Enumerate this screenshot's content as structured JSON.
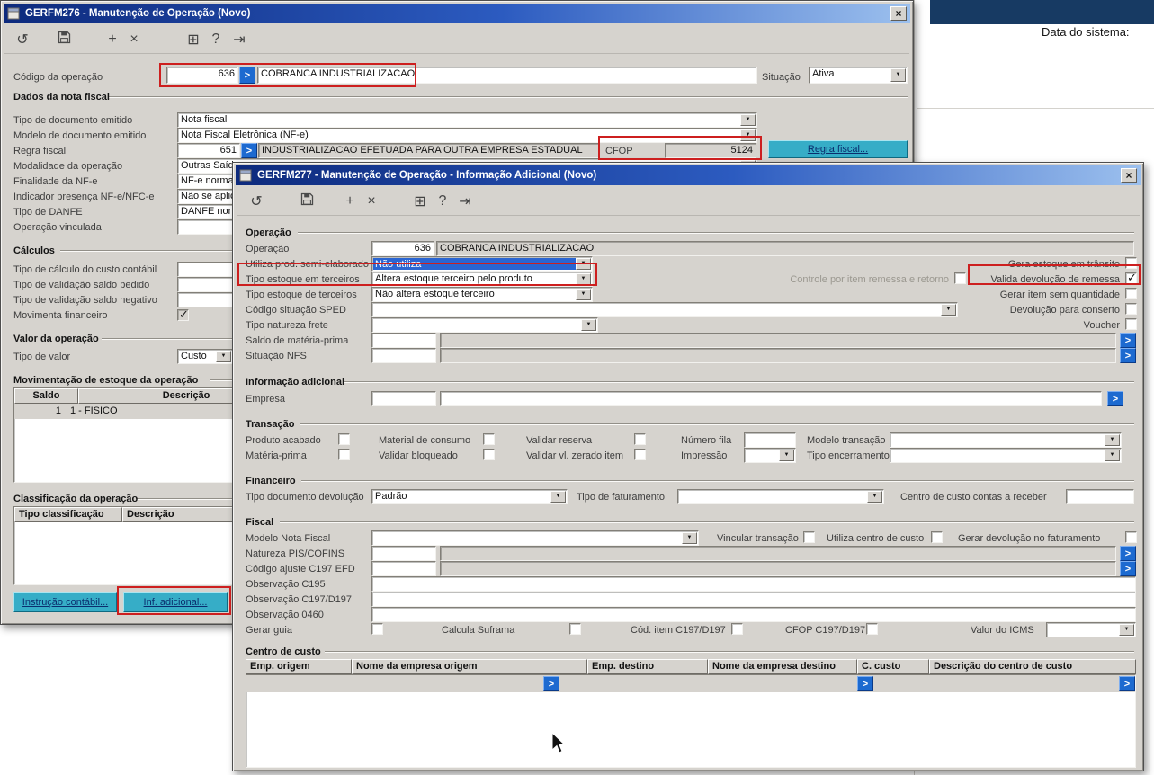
{
  "icons": {
    "undo": "↺",
    "new": "+",
    "delete": "×",
    "calendar": "⊞",
    "help": "?",
    "exit": "⇥",
    "close": "×",
    "dropdown": "▼",
    "lookup": ">"
  },
  "system_panel": {
    "date_label": "Data do sistema:"
  },
  "win276": {
    "title": "GERFM276 - Manutenção de Operação (Novo)",
    "codigo_label": "Código da operação",
    "codigo_value": "636",
    "codigo_desc": "COBRANCA INDUSTRIALIZACAO",
    "situacao_label": "Situação",
    "situacao_value": "Ativa",
    "nf": {
      "group": "Dados da nota fiscal",
      "tipo_doc_label": "Tipo de documento emitido",
      "tipo_doc_value": "Nota fiscal",
      "modelo_doc_label": "Modelo de documento emitido",
      "modelo_doc_value": "Nota Fiscal Eletrônica (NF-e)",
      "regra_label": "Regra fiscal",
      "regra_value": "651",
      "regra_desc": "INDUSTRIALIZACAO EFETUADA PARA OUTRA EMPRESA ESTADUAL",
      "cfop_label": "CFOP",
      "cfop_value": "5124",
      "regra_btn": "Regra fiscal...",
      "modalidade_label": "Modalidade da operação",
      "modalidade_value": "Outras Saídas",
      "finalidade_label": "Finalidade da NF-e",
      "finalidade_value": "NF-e normal",
      "indicador_label": "Indicador presença NF-e/NFC-e",
      "indicador_value": "Não se aplica",
      "danfe_label": "Tipo de DANFE",
      "danfe_value": "DANFE normal",
      "vinculada_label": "Operação vinculada"
    },
    "calc": {
      "group": "Cálculos",
      "custo_label": "Tipo de cálculo do custo contábil",
      "saldo_pedido_label": "Tipo de validação saldo pedido",
      "saldo_negativo_label": "Tipo de validação saldo negativo",
      "mov_financeiro_label": "Movimenta financeiro"
    },
    "valor": {
      "group": "Valor da operação",
      "tipo_label": "Tipo de valor",
      "tipo_value": "Custo"
    },
    "mov": {
      "group": "Movimentação de estoque da operação",
      "col1": "Saldo",
      "col2": "Descrição",
      "row_saldo": "1",
      "row_desc": "1 - FISICO"
    },
    "clas": {
      "group": "Classificação da operação",
      "col1": "Tipo classificação",
      "col2": "Descrição"
    },
    "btn_instrucao": "Instrução contábil...",
    "btn_inf": "Inf. adicional..."
  },
  "win277": {
    "title": "GERFM277 - Manutenção de Operação - Informação Adicional (Novo)",
    "op": {
      "group": "Operação",
      "operacao_label": "Operação",
      "operacao_value": "636",
      "operacao_desc": "COBRANCA INDUSTRIALIZACAO",
      "semi_label": "Utiliza prod. semi-elaborado",
      "semi_value": "Não utiliza",
      "estoque_em_label": "Tipo estoque em terceiros",
      "estoque_em_value": "Altera estoque terceiro pelo produto",
      "estoque_de_label": "Tipo estoque de terceiros",
      "estoque_de_value": "Não altera estoque terceiro",
      "sped_label": "Código situação SPED",
      "frete_label": "Tipo natureza frete",
      "saldo_mp_label": "Saldo de matéria-prima",
      "nfs_label": "Situação NFS",
      "chk_transito": "Gera estoque em trânsito",
      "chk_controle": "Controle por item remessa e retorno",
      "chk_valida": "Valida devolução de remessa",
      "chk_sem_qtd": "Gerar item sem quantidade",
      "chk_conserto": "Devolução para conserto",
      "chk_voucher": "Voucher"
    },
    "info": {
      "group": "Informação adicional",
      "empresa_label": "Empresa"
    },
    "trans": {
      "group": "Transação",
      "produto_acabado": "Produto acabado",
      "material_consumo": "Material de consumo",
      "validar_reserva": "Validar reserva",
      "numero_fila": "Número fila",
      "modelo_transacao": "Modelo transação",
      "materia_prima": "Matéria-prima",
      "validar_bloqueado": "Validar bloqueado",
      "validar_zerado": "Validar vl. zerado item",
      "impressao": "Impressão",
      "tipo_encerramento": "Tipo encerramento"
    },
    "fin": {
      "group": "Financeiro",
      "tipo_doc_label": "Tipo documento devolução",
      "tipo_doc_value": "Padrão",
      "faturamento_label": "Tipo de faturamento",
      "centro_custo_label": "Centro de custo contas a receber"
    },
    "fiscal": {
      "group": "Fiscal",
      "modelo_nf_label": "Modelo Nota Fiscal",
      "chk_vincular": "Vincular transação",
      "chk_utiliza_cc": "Utiliza centro de custo",
      "chk_gerar_dev": "Gerar devolução no faturamento",
      "natureza_label": "Natureza PIS/COFINS",
      "ajuste_label": "Código ajuste C197 EFD",
      "obs_c195_label": "Observação C195",
      "obs_c197_label": "Observação C197/D197",
      "obs_0460_label": "Observação 0460",
      "chk_gerar_guia": "Gerar guia",
      "chk_suframa": "Calcula Suframa",
      "chk_cod_item": "Cód. item C197/D197",
      "chk_cfop": "CFOP C197/D197",
      "valor_icms_label": "Valor do ICMS"
    },
    "cc": {
      "group": "Centro de custo",
      "cols": [
        "Emp. origem",
        "Nome da empresa origem",
        "Emp. destino",
        "Nome da empresa destino",
        "C. custo",
        "Descrição do centro de custo"
      ]
    }
  }
}
